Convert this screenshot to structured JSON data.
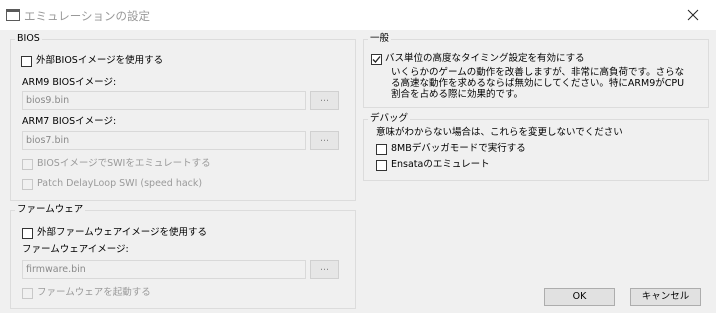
{
  "window": {
    "title": "エミュレーションの設定"
  },
  "bios": {
    "legend": "BIOS",
    "use_external": "外部BIOSイメージを使用する",
    "arm9_label": "ARM9 BIOSイメージ:",
    "arm9_value": "bios9.bin",
    "arm7_label": "ARM7 BIOSイメージ:",
    "arm7_value": "bios7.bin",
    "browse": "...",
    "swi_emulate": "BIOSイメージでSWIをエミュレートする",
    "patch_delay": "Patch DelayLoop SWI (speed hack)"
  },
  "firmware": {
    "legend": "ファームウェア",
    "use_external": "外部ファームウェアイメージを使用する",
    "image_label": "ファームウェアイメージ:",
    "image_value": "firmware.bin",
    "browse": "...",
    "boot": "ファームウェアを起動する"
  },
  "general": {
    "legend": "一般",
    "bus_timing": "バス単位の高度なタイミング設定を有効にする",
    "bus_timing_checked": true,
    "desc_line1": "いくらかのゲームの動作を改善しますが、非常に高負荷です。さらな",
    "desc_line2": "る高速な動作を求めるならば無効にしてください。特にARM9がCPU",
    "desc_line3": "割合を占める際に効果的です。"
  },
  "debug": {
    "legend": "デバッグ",
    "warning": "意味がわからない場合は、これらを変更しないでください",
    "mode_8mb": "8MBデバッガモードで実行する",
    "ensata": "Ensataのエミュレート"
  },
  "buttons": {
    "ok": "OK",
    "cancel": "キャンセル"
  }
}
